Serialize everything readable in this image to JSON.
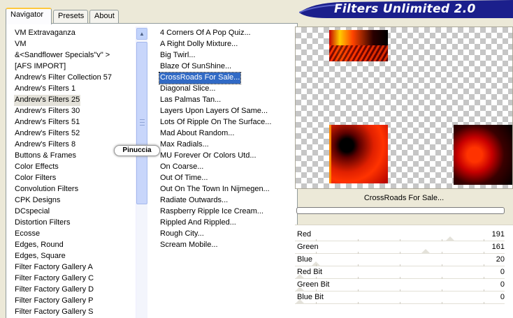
{
  "title": "Filters Unlimited 2.0",
  "tabs": [
    {
      "label": "Navigator",
      "active": true
    },
    {
      "label": "Presets",
      "active": false
    },
    {
      "label": "About",
      "active": false
    }
  ],
  "categories": [
    "VM Extravaganza",
    "VM",
    "&<Sandflower Specials\"v\" >",
    "[AFS IMPORT]",
    "Andrew's Filter Collection 57",
    "Andrew's Filters 1",
    "Andrew's Filters 25",
    "Andrew's Filters 30",
    "Andrew's Filters 51",
    "Andrew's Filters 52",
    "Andrew's Filters 8",
    "Buttons & Frames",
    "Color Effects",
    "Color Filters",
    "Convolution Filters",
    "CPK Designs",
    "DCspecial",
    "Distortion Filters",
    "Ecosse",
    "Edges, Round",
    "Edges, Square",
    "Filter Factory Gallery A",
    "Filter Factory Gallery C",
    "Filter Factory Gallery D",
    "Filter Factory Gallery P",
    "Filter Factory Gallery S"
  ],
  "selected_category": "Andrew's Filters 25",
  "filters": [
    "4 Corners Of A Pop Quiz...",
    "A Right Dolly Mixture...",
    "Big Twirl...",
    "Blaze Of SunShine...",
    "CrossRoads For Sale...",
    "Diagonal Slice...",
    "Las Palmas Tan...",
    "Layers Upon Layers Of Same...",
    "Lots Of Ripple On The Surface...",
    "Mad About Random...",
    "Max Radials...",
    "MU Forever Or Colors Utd...",
    "On Coarse...",
    "Out Of Time...",
    "Out On The Town In Nijmegen...",
    "Radiate Outwards...",
    "Raspberry Ripple Ice Cream...",
    "Rippled And Rippled...",
    "Rough City...",
    "Scream Mobile..."
  ],
  "selected_filter": "CrossRoads For Sale...",
  "watermark": "Pinuccia",
  "current_filter_display": "CrossRoads For Sale...",
  "sliders": [
    {
      "label": "Red",
      "value": "191",
      "level": 0.75
    },
    {
      "label": "Green",
      "value": "161",
      "level": 0.63
    },
    {
      "label": "Blue",
      "value": "20",
      "level": 0.08
    },
    {
      "label": "Red Bit",
      "value": "0",
      "level": 0
    },
    {
      "label": "Green Bit",
      "value": "0",
      "level": 0
    },
    {
      "label": "Blue Bit",
      "value": "0",
      "level": 0
    }
  ],
  "colors": {
    "banner": "#1B1F8C",
    "selection": "#316AC5",
    "tab_highlight": "#FFC83C"
  }
}
